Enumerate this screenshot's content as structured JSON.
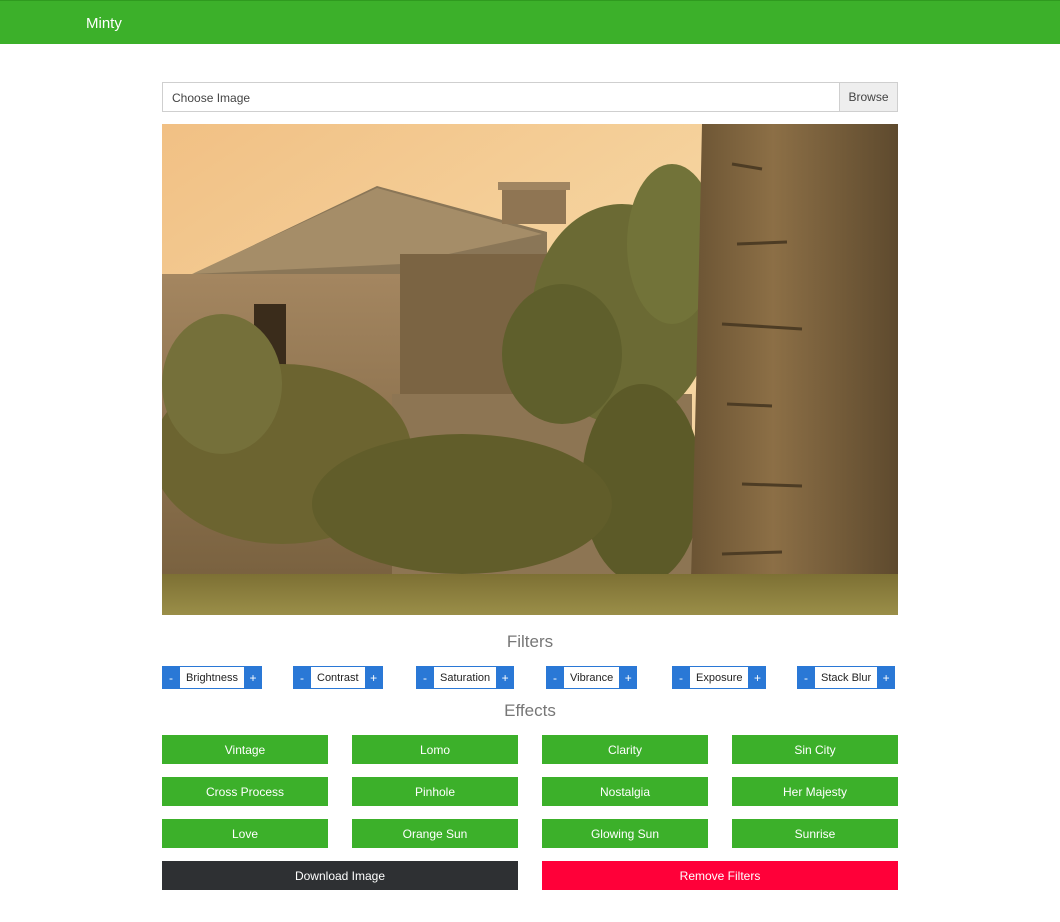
{
  "navbar": {
    "brand": "Minty"
  },
  "file_input": {
    "label": "Choose Image",
    "browse": "Browse"
  },
  "photo": {
    "tint": "sepia",
    "subject": "ruined-stone-cottage"
  },
  "filters": {
    "title": "Filters",
    "items": [
      {
        "minus": "-",
        "label": "Brightness",
        "plus": "+"
      },
      {
        "minus": "-",
        "label": "Contrast",
        "plus": "+"
      },
      {
        "minus": "-",
        "label": "Saturation",
        "plus": "+"
      },
      {
        "minus": "-",
        "label": "Vibrance",
        "plus": "+"
      },
      {
        "minus": "-",
        "label": "Exposure",
        "plus": "+"
      },
      {
        "minus": "-",
        "label": "Stack Blur",
        "plus": "+"
      }
    ]
  },
  "effects": {
    "title": "Effects",
    "items": [
      "Vintage",
      "Lomo",
      "Clarity",
      "Sin City",
      "Cross Process",
      "Pinhole",
      "Nostalgia",
      "Her Majesty",
      "Love",
      "Orange Sun",
      "Glowing Sun",
      "Sunrise"
    ]
  },
  "actions": {
    "download": "Download Image",
    "remove": "Remove Filters"
  },
  "colors": {
    "primary": "#3cb02a",
    "info": "#2a78d6",
    "dark": "#2e3033",
    "danger": "#ff0039"
  }
}
